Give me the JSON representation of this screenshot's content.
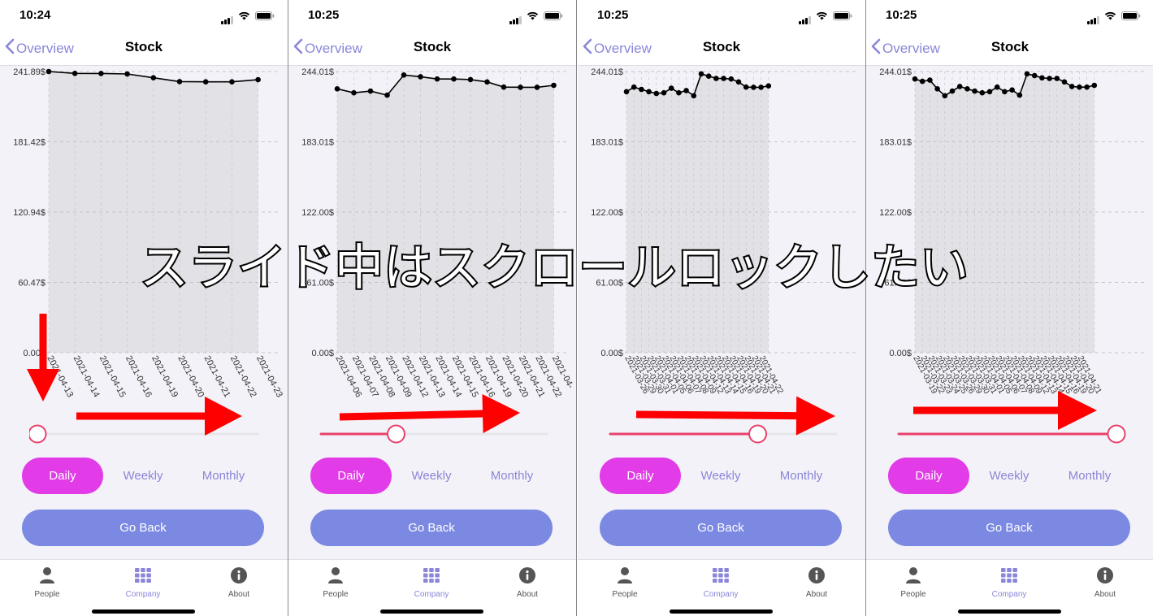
{
  "panels": [
    {
      "time": "10:24",
      "back_label": "Overview",
      "title": "Stock",
      "y_ticks": [
        "241.89$",
        "181.42$",
        "120.94$",
        "60.47$",
        "0.00$"
      ],
      "x_ticks": [
        "2021-04-13",
        "2021-04-14",
        "2021-04-15",
        "2021-04-16",
        "2021-04-19",
        "2021-04-20",
        "2021-04-21",
        "2021-04-22",
        "2021-04-23"
      ],
      "values": [
        241.89,
        240.3,
        240.2,
        239.8,
        236.5,
        233.2,
        233.0,
        233.0,
        234.8
      ],
      "ymax": 241.89,
      "slider_value": 0,
      "segments": [
        "Daily",
        "Weekly",
        "Monthly"
      ],
      "active_segment": "Daily",
      "go_back_label": "Go Back",
      "tabs": [
        "People",
        "Company",
        "About"
      ],
      "active_tab": "Company"
    },
    {
      "time": "10:25",
      "back_label": "Overview",
      "title": "Stock",
      "y_ticks": [
        "244.01$",
        "183.01$",
        "122.00$",
        "61.00$",
        "0.00$"
      ],
      "x_ticks": [
        "2021-04-06",
        "2021-04-07",
        "2021-04-08",
        "2021-04-09",
        "2021-04-12",
        "2021-04-13",
        "2021-04-14",
        "2021-04-15",
        "2021-04-16",
        "2021-04-19",
        "2021-04-20",
        "2021-04-21",
        "2021-04-22",
        "2021-04-"
      ],
      "values": [
        229.0,
        225.5,
        227.0,
        223.5,
        241.0,
        239.5,
        237.5,
        237.5,
        237.0,
        235.0,
        230.5,
        230.3,
        230.3,
        232.0
      ],
      "ymax": 244.01,
      "slider_value": 0.33,
      "segments": [
        "Daily",
        "Weekly",
        "Monthly"
      ],
      "active_segment": "Daily",
      "go_back_label": "Go Back",
      "tabs": [
        "People",
        "Company",
        "About"
      ],
      "active_tab": "Company"
    },
    {
      "time": "10:25",
      "back_label": "Overview",
      "title": "Stock",
      "y_ticks": [
        "244.01$",
        "183.01$",
        "122.00$",
        "61.00$",
        "0.00$"
      ],
      "x_ticks": [
        "2021-03-26",
        "2021-03-29",
        "2021-03-30",
        "2021-03-31",
        "2021-04-01",
        "2021-04-05",
        "2021-04-06",
        "2021-04-07",
        "2021-04-08",
        "2021-04-09",
        "2021-04-12",
        "2021-04-13",
        "2021-04-14",
        "2021-04-15",
        "2021-04-16",
        "2021-04-19",
        "2021-04-20",
        "2021-04-21",
        "2021-04-22"
      ],
      "values": [
        226.5,
        230.5,
        228.5,
        226.5,
        225.0,
        225.5,
        229.5,
        225.5,
        227.5,
        223.0,
        242.0,
        240.0,
        238.0,
        238.0,
        237.5,
        235.0,
        230.5,
        230.3,
        230.3,
        231.5
      ],
      "ymax": 244.01,
      "slider_value": 0.67,
      "segments": [
        "Daily",
        "Weekly",
        "Monthly"
      ],
      "active_segment": "Daily",
      "go_back_label": "Go Back",
      "tabs": [
        "People",
        "Company",
        "About"
      ],
      "active_tab": "Company"
    },
    {
      "time": "10:25",
      "back_label": "Overview",
      "title": "Stock",
      "y_ticks": [
        "244.01$",
        "183.01$",
        "122.00$",
        "61.00$",
        "0.00$"
      ],
      "x_ticks": [
        "2021-03-19",
        "2021-03-22",
        "2021-03-23",
        "2021-03-24",
        "2021-03-25",
        "2021-03-26",
        "2021-03-29",
        "2021-03-30",
        "2021-03-31",
        "2021-04-01",
        "2021-04-05",
        "2021-04-06",
        "2021-04-07",
        "2021-04-08",
        "2021-04-09",
        "2021-04-12",
        "2021-04-13",
        "2021-04-14",
        "2021-04-15",
        "2021-04-16",
        "2021-04-19",
        "2021-04-20",
        "2021-04-21"
      ],
      "values": [
        237.5,
        235.5,
        236.5,
        229.0,
        223.0,
        227.0,
        231.0,
        229.0,
        227.0,
        225.5,
        226.5,
        230.5,
        226.5,
        228.0,
        223.5,
        242.0,
        240.5,
        238.5,
        238.0,
        238.0,
        235.0,
        231.0,
        230.5,
        230.5,
        232.0
      ],
      "ymax": 244.01,
      "slider_value": 1,
      "segments": [
        "Daily",
        "Weekly",
        "Monthly"
      ],
      "active_segment": "Daily",
      "go_back_label": "Go Back",
      "tabs": [
        "People",
        "Company",
        "About"
      ],
      "active_tab": "Company"
    }
  ],
  "overlay_caption": "スライド中はスクロールロックしたい",
  "colors": {
    "accent": "#8a86d9",
    "segment_active": "#e23be8",
    "button": "#7b89e2",
    "slider_track_filled": "#e8416c",
    "slider_track_empty": "#e6e6ea",
    "chart_fill": "#e2e2e6",
    "line": "#000000",
    "annotation_arrow": "#ff0000"
  },
  "chart_data": [
    {
      "type": "area",
      "x": [
        "2021-04-13",
        "2021-04-14",
        "2021-04-15",
        "2021-04-16",
        "2021-04-19",
        "2021-04-20",
        "2021-04-21",
        "2021-04-22",
        "2021-04-23"
      ],
      "series": [
        {
          "values": [
            241.89,
            240.3,
            240.2,
            239.8,
            236.5,
            233.2,
            233.0,
            233.0,
            234.8
          ]
        }
      ],
      "ylim": [
        0,
        241.89
      ]
    },
    {
      "type": "area",
      "x": [
        "2021-04-06",
        "2021-04-07",
        "2021-04-08",
        "2021-04-09",
        "2021-04-12",
        "2021-04-13",
        "2021-04-14",
        "2021-04-15",
        "2021-04-16",
        "2021-04-19",
        "2021-04-20",
        "2021-04-21",
        "2021-04-22",
        "2021-04-"
      ],
      "series": [
        {
          "values": [
            229.0,
            225.5,
            227.0,
            223.5,
            241.0,
            239.5,
            237.5,
            237.5,
            237.0,
            235.0,
            230.5,
            230.3,
            230.3,
            232.0
          ]
        }
      ],
      "ylim": [
        0,
        244.01
      ]
    },
    {
      "type": "area",
      "x": [
        "2021-03-26",
        "2021-03-29",
        "2021-03-30",
        "2021-03-31",
        "2021-04-01",
        "2021-04-05",
        "2021-04-06",
        "2021-04-07",
        "2021-04-08",
        "2021-04-09",
        "2021-04-12",
        "2021-04-13",
        "2021-04-14",
        "2021-04-15",
        "2021-04-16",
        "2021-04-19",
        "2021-04-20",
        "2021-04-21",
        "2021-04-22"
      ],
      "series": [
        {
          "values": [
            226.5,
            230.5,
            228.5,
            226.5,
            225.0,
            225.5,
            229.5,
            225.5,
            227.5,
            223.0,
            242.0,
            240.0,
            238.0,
            238.0,
            237.5,
            235.0,
            230.5,
            230.3,
            230.3,
            231.5
          ]
        }
      ],
      "ylim": [
        0,
        244.01
      ]
    },
    {
      "type": "area",
      "x": [
        "2021-03-19",
        "2021-03-22",
        "2021-03-23",
        "2021-03-24",
        "2021-03-25",
        "2021-03-26",
        "2021-03-29",
        "2021-03-30",
        "2021-03-31",
        "2021-04-01",
        "2021-04-05",
        "2021-04-06",
        "2021-04-07",
        "2021-04-08",
        "2021-04-09",
        "2021-04-12",
        "2021-04-13",
        "2021-04-14",
        "2021-04-15",
        "2021-04-16",
        "2021-04-19",
        "2021-04-20",
        "2021-04-21"
      ],
      "series": [
        {
          "values": [
            237.5,
            235.5,
            236.5,
            229.0,
            223.0,
            227.0,
            231.0,
            229.0,
            227.0,
            225.5,
            226.5,
            230.5,
            226.5,
            228.0,
            223.5,
            242.0,
            240.5,
            238.5,
            238.0,
            238.0,
            235.0,
            231.0,
            230.5,
            230.5,
            232.0
          ]
        }
      ],
      "ylim": [
        0,
        244.01
      ]
    }
  ]
}
